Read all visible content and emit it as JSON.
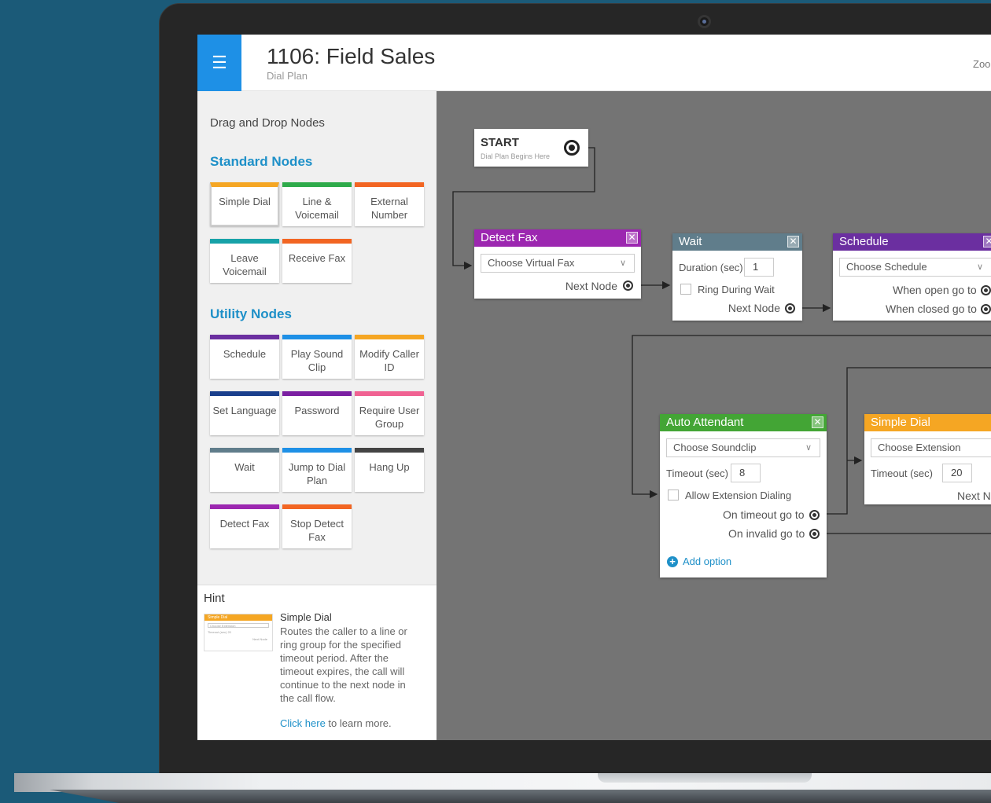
{
  "app": {
    "title": "1106: Field Sales",
    "subtitle": "Dial Plan",
    "zoom_label": "Zoo",
    "menu_icon": "hamburger-icon",
    "accent": "#1e90e6"
  },
  "sidebar": {
    "heading": "Drag and Drop Nodes",
    "standard_title": "Standard Nodes",
    "utility_title": "Utility Nodes",
    "standard_nodes": [
      {
        "label": "Simple Dial",
        "color": "#f5a623"
      },
      {
        "label": "Line & Voicemail",
        "color": "#2eaa4a"
      },
      {
        "label": "External Number",
        "color": "#f26522"
      },
      {
        "label": "Leave Voicemail",
        "color": "#17a2a8"
      },
      {
        "label": "Receive Fax",
        "color": "#f26522"
      }
    ],
    "utility_nodes": [
      {
        "label": "Schedule",
        "color": "#6b2fa0"
      },
      {
        "label": "Play Sound Clip",
        "color": "#1e90e6"
      },
      {
        "label": "Modify Caller ID",
        "color": "#f5a623"
      },
      {
        "label": "Set Language",
        "color": "#1a3f8c"
      },
      {
        "label": "Password",
        "color": "#7b1fa2"
      },
      {
        "label": "Require User Group",
        "color": "#f06292"
      },
      {
        "label": "Wait",
        "color": "#607d8b"
      },
      {
        "label": "Jump to Dial Plan",
        "color": "#1e90e6"
      },
      {
        "label": "Hang Up",
        "color": "#444444"
      },
      {
        "label": "Detect Fax",
        "color": "#9c27b0"
      },
      {
        "label": "Stop Detect Fax",
        "color": "#f26522"
      }
    ]
  },
  "hint": {
    "heading": "Hint",
    "title": "Simple Dial",
    "body": "Routes the caller to a line or ring group for the specified timeout period. After the timeout expires, the call will continue to the next node in the call flow.",
    "link_text": "Click here",
    "link_suffix": " to learn more.",
    "thumb": {
      "header": "Simple Dial",
      "field": "Choose Extension",
      "timeout": "Timeout (sec)",
      "timeout_value": "20",
      "next": "Next Node"
    }
  },
  "canvas": {
    "start": {
      "title": "START",
      "subtitle": "Dial Plan Begins Here"
    },
    "detect_fax": {
      "title": "Detect Fax",
      "color": "#9c27b0",
      "select": "Choose Virtual Fax",
      "next": "Next Node"
    },
    "wait": {
      "title": "Wait",
      "color": "#607d8b",
      "duration_label": "Duration (sec)",
      "duration": "1",
      "ring_label": "Ring During Wait",
      "next": "Next Node"
    },
    "schedule": {
      "title": "Schedule",
      "color": "#6b2fa0",
      "select": "Choose Schedule",
      "open": "When open go to",
      "closed": "When closed go to"
    },
    "auto_attendant": {
      "title": "Auto Attendant",
      "color": "#43a535",
      "select": "Choose Soundclip",
      "timeout_label": "Timeout (sec)",
      "timeout": "8",
      "ext_label": "Allow Extension Dialing",
      "on_timeout": "On timeout go to",
      "on_invalid": "On invalid go to",
      "add_option": "Add option"
    },
    "simple_dial": {
      "title": "Simple Dial",
      "color": "#f5a623",
      "select": "Choose Extension",
      "timeout_label": "Timeout (sec)",
      "timeout": "20",
      "next": "Next N"
    }
  }
}
